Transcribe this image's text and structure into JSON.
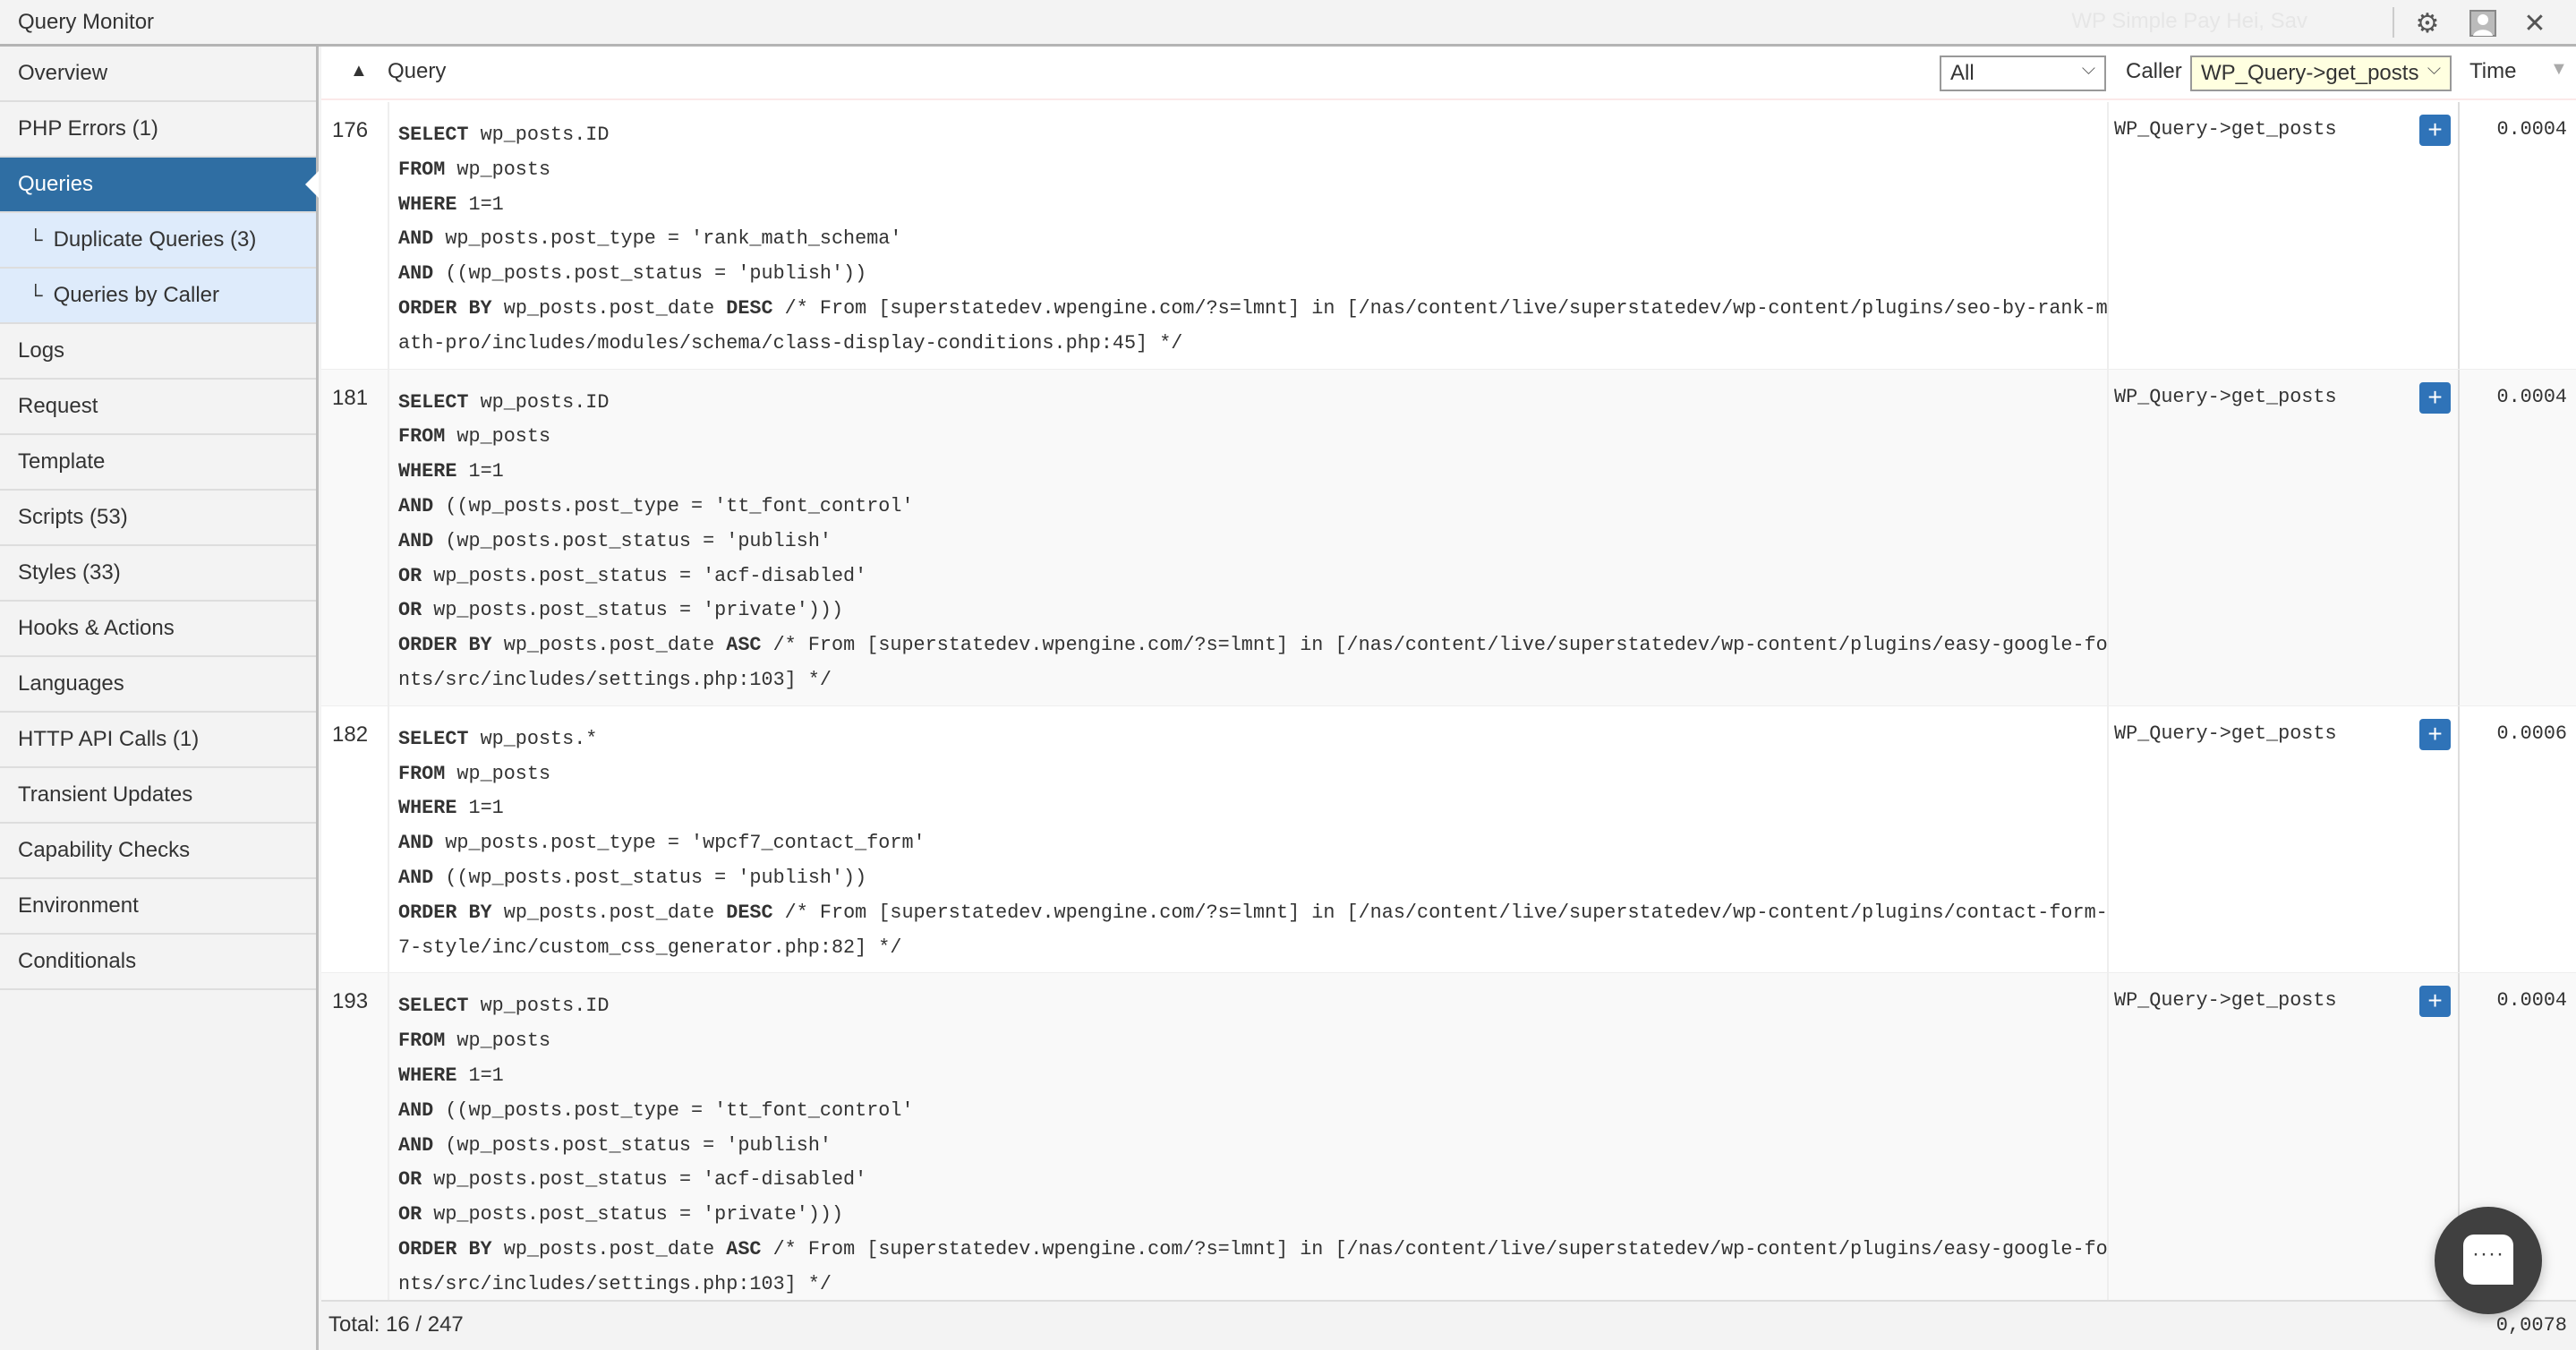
{
  "topbar": {
    "title": "Query Monitor",
    "ghost_text": "WP Simple Pay    Hei, Sav",
    "icons": [
      "settings-gear-icon",
      "toggle-panel-icon",
      "close-icon"
    ]
  },
  "sidebar": {
    "items": [
      {
        "label": "Overview"
      },
      {
        "label": "PHP Errors (1)"
      },
      {
        "label": "Queries",
        "active": true
      },
      {
        "label": "Duplicate Queries (3)",
        "sub": true
      },
      {
        "label": "Queries by Caller",
        "sub": true
      },
      {
        "label": "Logs"
      },
      {
        "label": "Request"
      },
      {
        "label": "Template"
      },
      {
        "label": "Scripts (53)"
      },
      {
        "label": "Styles (33)"
      },
      {
        "label": "Hooks & Actions"
      },
      {
        "label": "Languages"
      },
      {
        "label": "HTTP API Calls (1)"
      },
      {
        "label": "Transient Updates"
      },
      {
        "label": "Capability Checks"
      },
      {
        "label": "Environment"
      },
      {
        "label": "Conditionals"
      }
    ],
    "tree_glyph": "└"
  },
  "table": {
    "sort_arrow": "▲",
    "query_header": "Query",
    "type_filter": "All",
    "caller_header": "Caller",
    "caller_filter": "WP_Query->get_posts",
    "time_header": "Time",
    "time_sort": "▼",
    "highlight_color": "#ffffe0",
    "accent": "#2f6ea3",
    "rows": [
      {
        "num": "176",
        "caller": "WP_Query->get_posts",
        "time": "0.0004",
        "lines": [
          [
            {
              "b": "SELECT"
            },
            {
              "t": " wp_posts.ID"
            }
          ],
          [
            {
              "b": "FROM"
            },
            {
              "t": " wp_posts"
            }
          ],
          [
            {
              "b": "WHERE"
            },
            {
              "t": " 1=1"
            }
          ],
          [
            {
              "b": "AND"
            },
            {
              "t": " wp_posts.post_type = 'rank_math_schema'"
            }
          ],
          [
            {
              "b": "AND"
            },
            {
              "t": " ((wp_posts.post_status = 'publish'))"
            }
          ],
          [
            {
              "b": "ORDER BY"
            },
            {
              "t": " wp_posts.post_date "
            },
            {
              "b": "DESC"
            },
            {
              "t": " /* From [superstatedev.wpengine.com/?s=lmnt] in [/nas/content/live/superstatedev/wp-content/plugins/seo-by-rank-math-pro/includes/modules/schema/class-display-conditions.php:45] */"
            }
          ]
        ]
      },
      {
        "num": "181",
        "caller": "WP_Query->get_posts",
        "time": "0.0004",
        "lines": [
          [
            {
              "b": "SELECT"
            },
            {
              "t": " wp_posts.ID"
            }
          ],
          [
            {
              "b": "FROM"
            },
            {
              "t": " wp_posts"
            }
          ],
          [
            {
              "b": "WHERE"
            },
            {
              "t": " 1=1"
            }
          ],
          [
            {
              "b": "AND"
            },
            {
              "t": " ((wp_posts.post_type = 'tt_font_control'"
            }
          ],
          [
            {
              "b": "AND"
            },
            {
              "t": " (wp_posts.post_status = 'publish'"
            }
          ],
          [
            {
              "b": "OR"
            },
            {
              "t": " wp_posts.post_status = 'acf-disabled'"
            }
          ],
          [
            {
              "b": "OR"
            },
            {
              "t": " wp_posts.post_status = 'private')))"
            }
          ],
          [
            {
              "b": "ORDER BY"
            },
            {
              "t": " wp_posts.post_date "
            },
            {
              "b": "ASC"
            },
            {
              "t": " /* From [superstatedev.wpengine.com/?s=lmnt] in [/nas/content/live/superstatedev/wp-content/plugins/easy-google-fonts/src/includes/settings.php:103] */"
            }
          ]
        ]
      },
      {
        "num": "182",
        "caller": "WP_Query->get_posts",
        "time": "0.0006",
        "lines": [
          [
            {
              "b": "SELECT"
            },
            {
              "t": " wp_posts.*"
            }
          ],
          [
            {
              "b": "FROM"
            },
            {
              "t": " wp_posts"
            }
          ],
          [
            {
              "b": "WHERE"
            },
            {
              "t": " 1=1"
            }
          ],
          [
            {
              "b": "AND"
            },
            {
              "t": " wp_posts.post_type = 'wpcf7_contact_form'"
            }
          ],
          [
            {
              "b": "AND"
            },
            {
              "t": " ((wp_posts.post_status = 'publish'))"
            }
          ],
          [
            {
              "b": "ORDER BY"
            },
            {
              "t": " wp_posts.post_date "
            },
            {
              "b": "DESC"
            },
            {
              "t": " /* From [superstatedev.wpengine.com/?s=lmnt] in [/nas/content/live/superstatedev/wp-content/plugins/contact-form-7-style/inc/custom_css_generator.php:82] */"
            }
          ]
        ]
      },
      {
        "num": "193",
        "caller": "WP_Query->get_posts",
        "time": "0.0004",
        "lines": [
          [
            {
              "b": "SELECT"
            },
            {
              "t": " wp_posts.ID"
            }
          ],
          [
            {
              "b": "FROM"
            },
            {
              "t": " wp_posts"
            }
          ],
          [
            {
              "b": "WHERE"
            },
            {
              "t": " 1=1"
            }
          ],
          [
            {
              "b": "AND"
            },
            {
              "t": " ((wp_posts.post_type = 'tt_font_control'"
            }
          ],
          [
            {
              "b": "AND"
            },
            {
              "t": " (wp_posts.post_status = 'publish'"
            }
          ],
          [
            {
              "b": "OR"
            },
            {
              "t": " wp_posts.post_status = 'acf-disabled'"
            }
          ],
          [
            {
              "b": "OR"
            },
            {
              "t": " wp_posts.post_status = 'private')))"
            }
          ],
          [
            {
              "b": "ORDER BY"
            },
            {
              "t": " wp_posts.post_date "
            },
            {
              "b": "ASC"
            },
            {
              "t": " /* From [superstatedev.wpengine.com/?s=lmnt] in [/nas/content/live/superstatedev/wp-content/plugins/easy-google-fonts/src/includes/settings.php:103] */"
            }
          ]
        ]
      }
    ],
    "plus_label": "+"
  },
  "footer": {
    "total": "Total: 16 / 247",
    "time_total": "0,0078"
  },
  "chat": {
    "icon": "chat-bubble-icon",
    "dots": "····"
  }
}
